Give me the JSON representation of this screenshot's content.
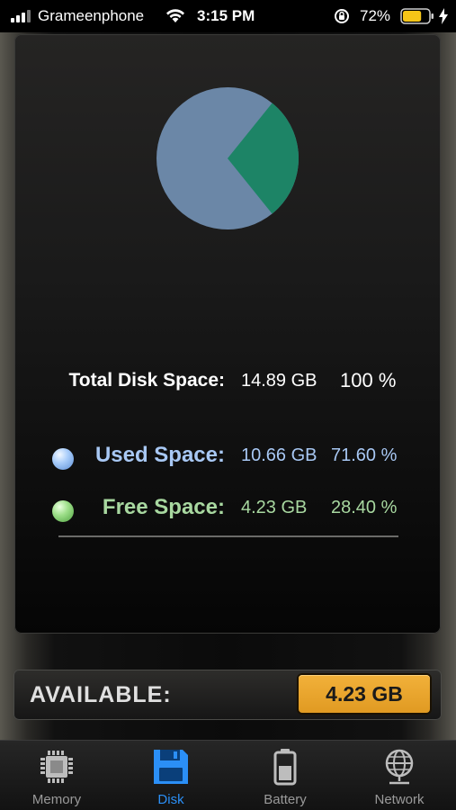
{
  "status_bar": {
    "carrier": "Grameenphone",
    "time": "3:15 PM",
    "battery_percent": "72%",
    "battery_level": 0.72,
    "icons": [
      "signal-icon",
      "wifi-icon",
      "orientation-lock-icon",
      "battery-icon",
      "charging-bolt-icon"
    ]
  },
  "disk": {
    "pie": {
      "used_fraction": 0.716,
      "free_fraction": 0.284,
      "used_color": "#6b87a7",
      "free_color": "#1d8466"
    },
    "total": {
      "label": "Total Disk Space:",
      "value": "14.89 GB",
      "percent": "100 %"
    },
    "used": {
      "label": "Used Space:",
      "value": "10.66 GB",
      "percent": "71.60 %"
    },
    "free": {
      "label": "Free Space:",
      "value": "4.23 GB",
      "percent": "28.40 %"
    }
  },
  "available": {
    "label": "AVAILABLE:",
    "value": "4.23 GB"
  },
  "colors": {
    "accent": "#2b8ff6",
    "available_badge": "#eca52c",
    "used_text": "#a8c8f4",
    "free_text": "#a8d8a0"
  },
  "tabs": [
    {
      "label": "Memory",
      "icon": "chip-icon",
      "active": false
    },
    {
      "label": "Disk",
      "icon": "floppy-disk-icon",
      "active": true
    },
    {
      "label": "Battery",
      "icon": "battery-tab-icon",
      "active": false
    },
    {
      "label": "Network",
      "icon": "globe-network-icon",
      "active": false
    }
  ]
}
